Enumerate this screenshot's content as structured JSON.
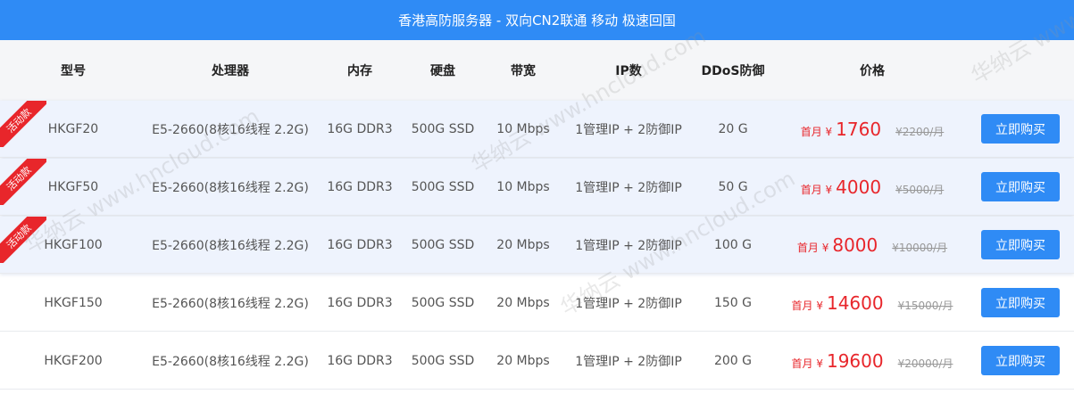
{
  "banner": {
    "title": "香港高防服务器 - 双向CN2联通 移动 极速回国"
  },
  "columns": {
    "model": "型号",
    "cpu": "处理器",
    "memory": "内存",
    "disk": "硬盘",
    "bandwidth": "带宽",
    "ip": "IP数",
    "ddos": "DDoS防御",
    "price": "价格"
  },
  "badge_label": "活动款",
  "price_prefix": "首月 ¥",
  "buy_label": "立即购买",
  "rows": [
    {
      "model": "HKGF20",
      "cpu": "E5-2660(8核16线程 2.2G)",
      "memory": "16G DDR3",
      "disk": "500G SSD",
      "bandwidth": "10 Mbps",
      "ip": "1管理IP + 2防御IP",
      "ddos": "20 G",
      "price": "1760",
      "old_price": "¥2200/月"
    },
    {
      "model": "HKGF50",
      "cpu": "E5-2660(8核16线程 2.2G)",
      "memory": "16G DDR3",
      "disk": "500G SSD",
      "bandwidth": "10 Mbps",
      "ip": "1管理IP + 2防御IP",
      "ddos": "50 G",
      "price": "4000",
      "old_price": "¥5000/月"
    },
    {
      "model": "HKGF100",
      "cpu": "E5-2660(8核16线程 2.2G)",
      "memory": "16G DDR3",
      "disk": "500G SSD",
      "bandwidth": "20 Mbps",
      "ip": "1管理IP + 2防御IP",
      "ddos": "100 G",
      "price": "8000",
      "old_price": "¥10000/月"
    },
    {
      "model": "HKGF150",
      "cpu": "E5-2660(8核16线程 2.2G)",
      "memory": "16G DDR3",
      "disk": "500G SSD",
      "bandwidth": "20 Mbps",
      "ip": "1管理IP + 2防御IP",
      "ddos": "150 G",
      "price": "14600",
      "old_price": "¥15000/月"
    },
    {
      "model": "HKGF200",
      "cpu": "E5-2660(8核16线程 2.2G)",
      "memory": "16G DDR3",
      "disk": "500G SSD",
      "bandwidth": "20 Mbps",
      "ip": "1管理IP + 2防御IP",
      "ddos": "200 G",
      "price": "19600",
      "old_price": "¥20000/月"
    }
  ],
  "watermark": [
    "华纳云 www.hncloud.com"
  ],
  "colors": {
    "banner": "#2f8bf5",
    "accent_red": "#e8262b",
    "header_bg": "#f5f6f8",
    "highlight_row": "#eef3fd"
  }
}
